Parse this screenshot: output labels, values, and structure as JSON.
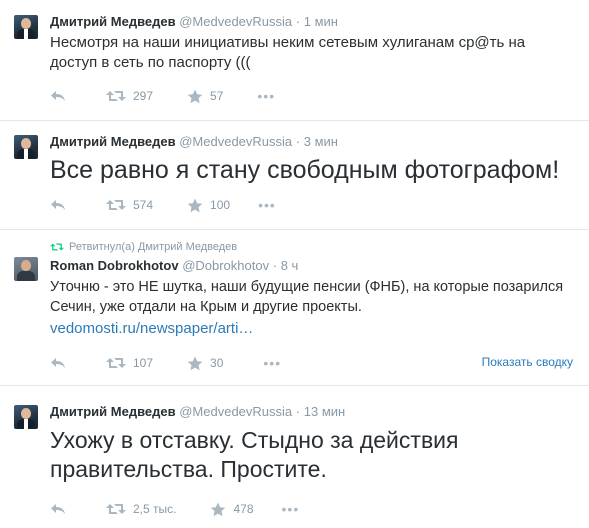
{
  "tweets": [
    {
      "fullname": "Дмитрий Медведев",
      "username": "@MedvedevRussia",
      "dot": "·",
      "time": "1 мин",
      "text": "Несмотря на наши инициативы неким сетевым хулиганам ср@ть на доступ в сеть по паспорту  (((",
      "retweets": "297",
      "favorites": "57",
      "more": "•••"
    },
    {
      "fullname": "Дмитрий Медведев",
      "username": "@MedvedevRussia",
      "dot": "·",
      "time": "3 мин",
      "text": "Все равно я стану свободным фотографом!",
      "retweets": "574",
      "favorites": "100",
      "more": "•••"
    },
    {
      "retweet_context": "Ретвитнул(а) Дмитрий Медведев",
      "fullname": "Roman Dobrokhotov",
      "username": "@Dobrokhotov",
      "dot": "·",
      "time": "8 ч",
      "text": "Уточню - это НЕ шутка, наши будущие пенсии (ФНБ), на которые позарился Сечин, уже отдали на Крым и другие проекты.",
      "link": "vedomosti.ru/newspaper/arti…",
      "retweets": "107",
      "favorites": "30",
      "more": "•••",
      "expand": "Показать сводку"
    },
    {
      "fullname": "Дмитрий Медведев",
      "username": "@MedvedevRussia",
      "dot": "·",
      "time": "13 мин",
      "text": "Ухожу в отставку. Стыдно за действия правительства. Простите.",
      "retweets": "2,5 тыс.",
      "favorites": "478",
      "more": "•••"
    }
  ],
  "colors": {
    "link": "#2b7bb9",
    "muted": "#8899a6",
    "text": "#292f33",
    "border": "#e1e8ed",
    "retweet_green": "#19cf86"
  },
  "icons": [
    "reply-icon",
    "retweet-icon",
    "favorite-star-icon",
    "more-icon"
  ]
}
